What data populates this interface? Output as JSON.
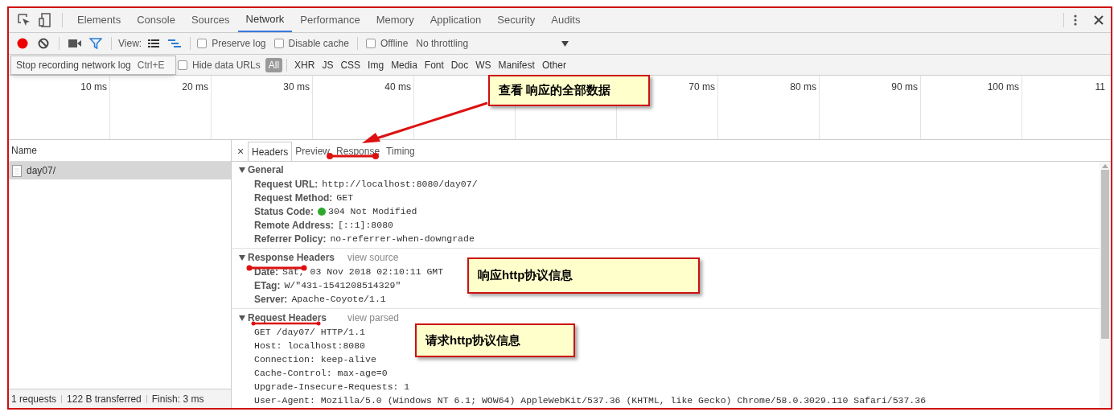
{
  "devtools_tabs": [
    {
      "label": "Elements",
      "selected": false
    },
    {
      "label": "Console",
      "selected": false
    },
    {
      "label": "Sources",
      "selected": false
    },
    {
      "label": "Network",
      "selected": true
    },
    {
      "label": "Performance",
      "selected": false
    },
    {
      "label": "Memory",
      "selected": false
    },
    {
      "label": "Application",
      "selected": false
    },
    {
      "label": "Security",
      "selected": false
    },
    {
      "label": "Audits",
      "selected": false
    }
  ],
  "toolbar": {
    "recording": true,
    "view_label": "View:",
    "options": [
      {
        "label": "Preserve log",
        "checked": false
      },
      {
        "label": "Disable cache",
        "checked": false
      },
      {
        "label": "Offline",
        "checked": false
      }
    ],
    "throttling": "No throttling"
  },
  "tooltip": {
    "text": "Stop recording network log",
    "shortcut": "Ctrl+E"
  },
  "filter_bar": {
    "hide_data_urls": {
      "label": "Hide data URLs",
      "checked": false
    },
    "types": [
      {
        "label": "All",
        "selected": true
      },
      {
        "label": "XHR",
        "selected": false
      },
      {
        "label": "JS",
        "selected": false
      },
      {
        "label": "CSS",
        "selected": false
      },
      {
        "label": "Img",
        "selected": false
      },
      {
        "label": "Media",
        "selected": false
      },
      {
        "label": "Font",
        "selected": false
      },
      {
        "label": "Doc",
        "selected": false
      },
      {
        "label": "WS",
        "selected": false
      },
      {
        "label": "Manifest",
        "selected": false
      },
      {
        "label": "Other",
        "selected": false
      }
    ]
  },
  "timeline": {
    "ticks_before_note": [
      "10 ms",
      "20 ms",
      "30 ms",
      "40 ms"
    ],
    "ticks_after_note": [
      "70 ms",
      "80 ms",
      "90 ms",
      "100 ms",
      "11"
    ]
  },
  "requests": {
    "column": "Name",
    "rows": [
      {
        "name": "day07/",
        "selected": true
      }
    ],
    "status": [
      "1 requests",
      "122 B transferred",
      "Finish: 3 ms"
    ]
  },
  "details": {
    "close": "×",
    "tabs": [
      {
        "label": "Headers",
        "selected": true
      },
      {
        "label": "Preview",
        "selected": false
      },
      {
        "label": "Response",
        "selected": false
      },
      {
        "label": "Timing",
        "selected": false
      }
    ],
    "sections": [
      {
        "title": "General",
        "expanded": true,
        "rows": [
          {
            "kind": "pair",
            "key": "Request URL:",
            "value": "http://localhost:8080/day07/"
          },
          {
            "kind": "pair",
            "key": "Request Method:",
            "value": "GET"
          },
          {
            "kind": "status",
            "key": "Status Code:",
            "value": "304 Not Modified"
          },
          {
            "kind": "pair",
            "key": "Remote Address:",
            "value": "[::1]:8080"
          },
          {
            "kind": "pair",
            "key": "Referrer Policy:",
            "value": "no-referrer-when-downgrade"
          }
        ]
      },
      {
        "title": "Response Headers",
        "link": "view source",
        "expanded": true,
        "rows": [
          {
            "kind": "pair",
            "key": "Date:",
            "value": "Sat, 03 Nov 2018 02:10:11 GMT"
          },
          {
            "kind": "pair",
            "key": "ETag:",
            "value": "W/\"431-1541208514329\""
          },
          {
            "kind": "pair",
            "key": "Server:",
            "value": "Apache-Coyote/1.1"
          }
        ]
      },
      {
        "title": "Request Headers",
        "link": "view parsed",
        "expanded": true,
        "rows": [
          {
            "kind": "raw",
            "value": "GET /day07/ HTTP/1.1"
          },
          {
            "kind": "raw",
            "value": "Host: localhost:8080"
          },
          {
            "kind": "raw",
            "value": "Connection: keep-alive"
          },
          {
            "kind": "raw",
            "value": "Cache-Control: max-age=0"
          },
          {
            "kind": "raw",
            "value": "Upgrade-Insecure-Requests: 1"
          },
          {
            "kind": "raw",
            "value": "User-Agent: Mozilla/5.0 (Windows NT 6.1; WOW64) AppleWebKit/537.36 (KHTML, like Gecko) Chrome/58.0.3029.110 Safari/537.36"
          }
        ]
      }
    ]
  },
  "annotations": [
    {
      "text": "查看 响应的全部数据"
    },
    {
      "text": "响应http协议信息"
    },
    {
      "text": "请求http协议信息"
    }
  ]
}
